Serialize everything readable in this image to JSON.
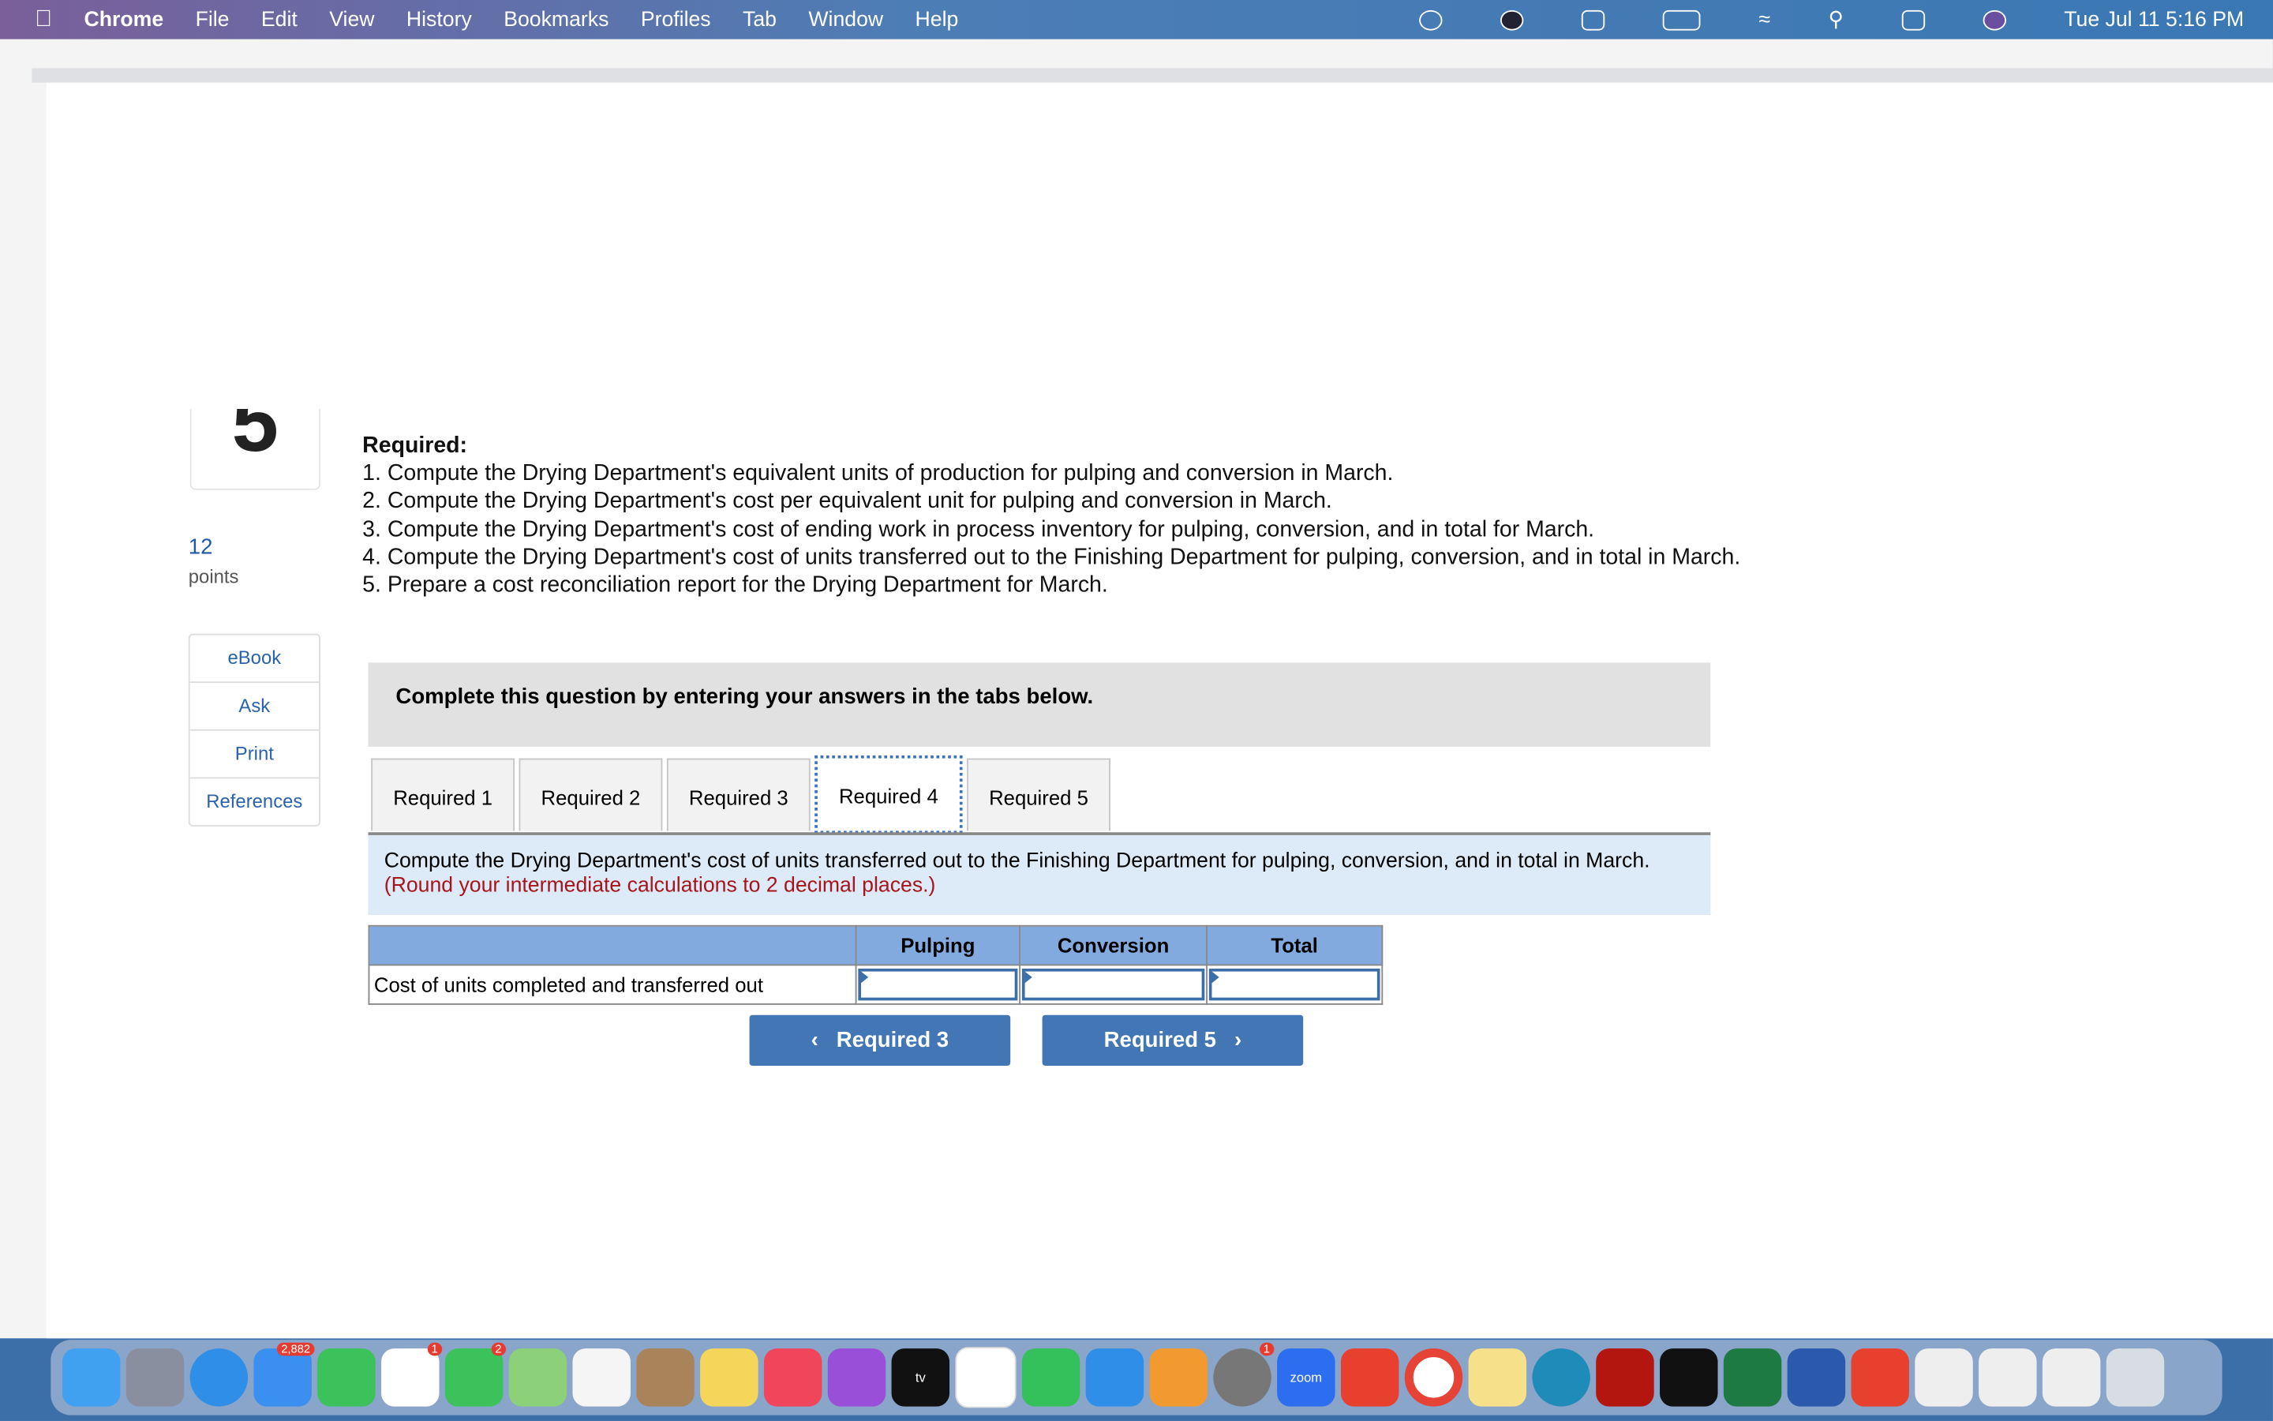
{
  "menubar": {
    "app": "Chrome",
    "items": [
      "File",
      "Edit",
      "View",
      "History",
      "Bookmarks",
      "Profiles",
      "Tab",
      "Window",
      "Help"
    ],
    "clock": "Tue Jul 11  5:16 PM"
  },
  "question": {
    "number_glyph": "5",
    "points": "12",
    "points_label": "points"
  },
  "side_buttons": [
    "eBook",
    "Ask",
    "Print",
    "References"
  ],
  "required": {
    "heading": "Required:",
    "items": [
      "1. Compute the Drying Department's equivalent units of production for pulping and conversion in March.",
      "2. Compute the Drying Department's cost per equivalent unit for pulping and conversion in March.",
      "3. Compute the Drying Department's cost of ending work in process inventory for pulping, conversion, and in total for March.",
      "4. Compute the Drying Department's cost of units transferred out to the Finishing Department for pulping, conversion, and in total in March.",
      "5. Prepare a cost reconciliation report for the Drying Department for March."
    ]
  },
  "banner": "Complete this question by entering your answers in the tabs below.",
  "tabs": [
    "Required 1",
    "Required 2",
    "Required 3",
    "Required 4",
    "Required 5"
  ],
  "active_tab": "Required 4",
  "instructions": {
    "text": "Compute the Drying Department's cost of units transferred out to the Finishing Department for pulping, conversion, and in total in March.",
    "note": "(Round your intermediate calculations to 2 decimal places.)"
  },
  "table": {
    "headers": [
      "",
      "Pulping",
      "Conversion",
      "Total"
    ],
    "row_label": "Cost of units completed and transferred out",
    "values": [
      "",
      "",
      ""
    ]
  },
  "nav": {
    "prev": "Required 3",
    "next": "Required 5"
  },
  "dock": {
    "mail_badge": "2,882",
    "reminders_badge": "1",
    "messages_badge": "2",
    "settings_badge": "1",
    "zoom_label": "zoom",
    "tv_label": "tv"
  }
}
